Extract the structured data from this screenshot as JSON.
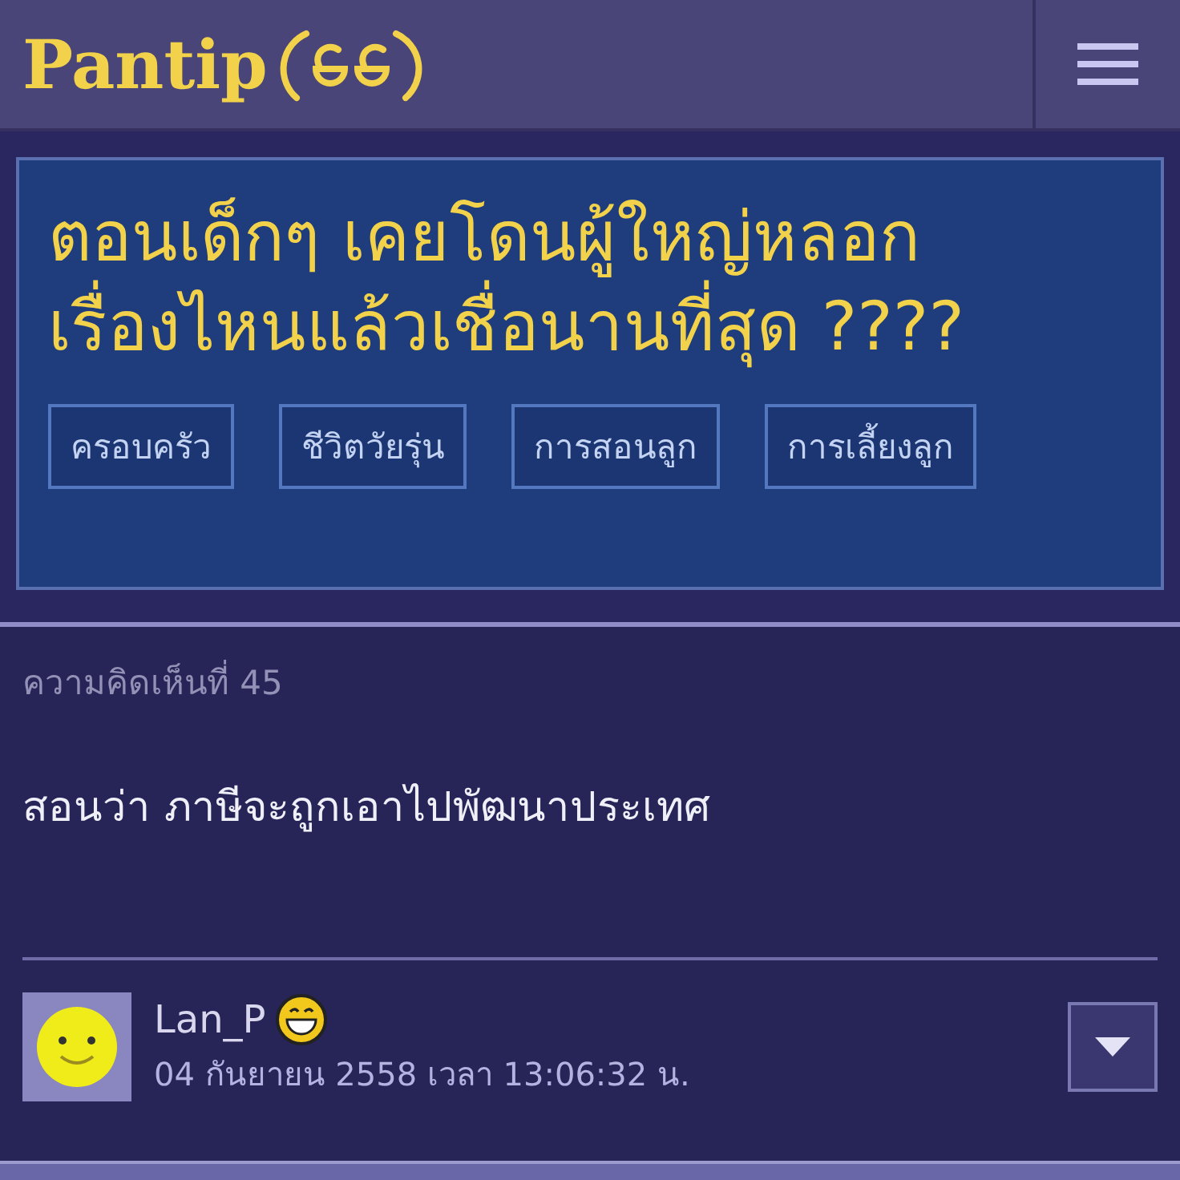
{
  "header": {
    "logo_text": "Pantip"
  },
  "topic": {
    "title_lines": [
      "ตอนเด็กๆ เคยโดนผู้ใหญ่หลอก",
      "เรื่องไหนแล้วเชื่อนานที่สุด ????"
    ],
    "tags": [
      "ครอบครัว",
      "ชีวิตวัยรุ่น",
      "การสอนลูก",
      "การเลี้ยงลูก"
    ]
  },
  "comment": {
    "label": "ความคิดเห็นที่ 45",
    "body": "สอนว่า ภาษีจะถูกเอาไปพัฒนาประเทศ",
    "author": "Lan_P",
    "date": "04 กันยายน 2558 เวลา 13:06:32 น."
  }
}
